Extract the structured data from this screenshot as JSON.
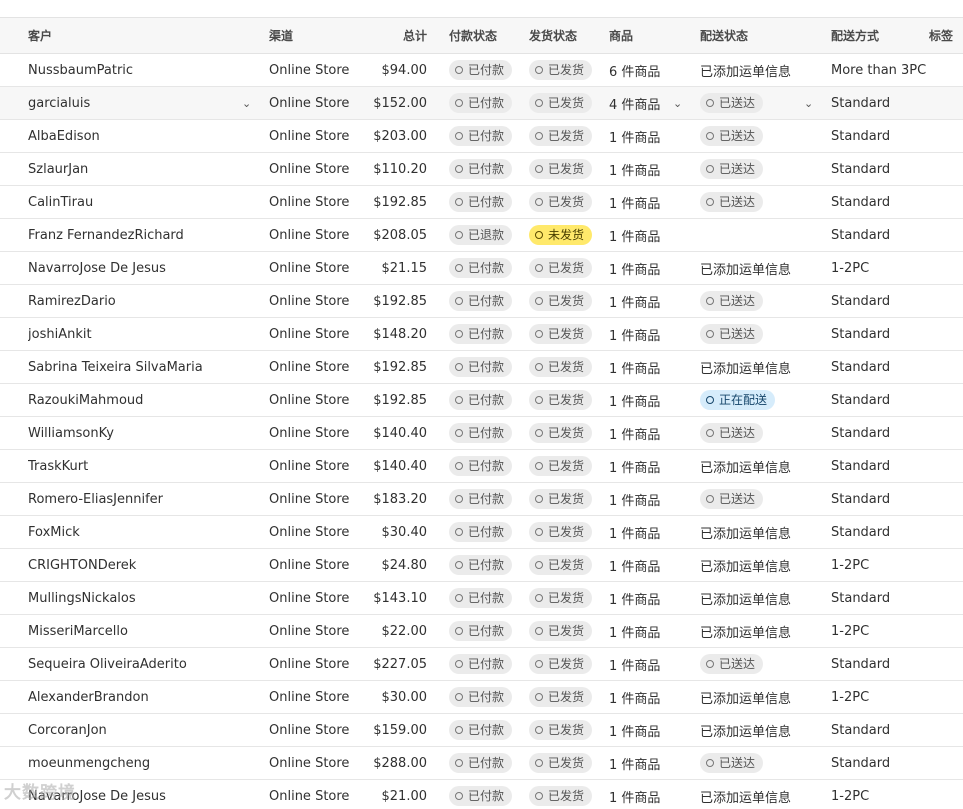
{
  "columns": {
    "customer": "客户",
    "channel": "渠道",
    "total": "总计",
    "payment": "付款状态",
    "fulfillment": "发货状态",
    "items": "商品",
    "delivery": "配送状态",
    "method": "配送方式",
    "tags": "标签"
  },
  "rows": [
    {
      "customer": "NussbaumPatric",
      "channel": "Online Store",
      "total": "$94.00",
      "payment": "已付款",
      "fulfillment": "已发货",
      "fulfillment_type": "neutral",
      "items": "6 件商品",
      "delivery": "已添加运单信息",
      "delivery_type": "text",
      "method": "More than 3PC"
    },
    {
      "customer": "garcialuis",
      "channel": "Online Store",
      "total": "$152.00",
      "payment": "已付款",
      "fulfillment": "已发货",
      "fulfillment_type": "neutral",
      "items": "4 件商品",
      "delivery": "已送达",
      "delivery_type": "badge",
      "method": "Standard"
    },
    {
      "customer": "AlbaEdison",
      "channel": "Online Store",
      "total": "$203.00",
      "payment": "已付款",
      "fulfillment": "已发货",
      "fulfillment_type": "neutral",
      "items": "1 件商品",
      "delivery": "已送达",
      "delivery_type": "badge",
      "method": "Standard"
    },
    {
      "customer": "SzlaurJan",
      "channel": "Online Store",
      "total": "$110.20",
      "payment": "已付款",
      "fulfillment": "已发货",
      "fulfillment_type": "neutral",
      "items": "1 件商品",
      "delivery": "已送达",
      "delivery_type": "badge",
      "method": "Standard"
    },
    {
      "customer": "CalinTirau",
      "channel": "Online Store",
      "total": "$192.85",
      "payment": "已付款",
      "fulfillment": "已发货",
      "fulfillment_type": "neutral",
      "items": "1 件商品",
      "delivery": "已送达",
      "delivery_type": "badge",
      "method": "Standard"
    },
    {
      "customer": "Franz FernandezRichard",
      "channel": "Online Store",
      "total": "$208.05",
      "payment": "已退款",
      "fulfillment": "未发货",
      "fulfillment_type": "warn",
      "items": "1 件商品",
      "delivery": "",
      "delivery_type": "none",
      "method": "Standard"
    },
    {
      "customer": "NavarroJose De Jesus",
      "channel": "Online Store",
      "total": "$21.15",
      "payment": "已付款",
      "fulfillment": "已发货",
      "fulfillment_type": "neutral",
      "items": "1 件商品",
      "delivery": "已添加运单信息",
      "delivery_type": "text",
      "method": "1-2PC"
    },
    {
      "customer": "RamirezDario",
      "channel": "Online Store",
      "total": "$192.85",
      "payment": "已付款",
      "fulfillment": "已发货",
      "fulfillment_type": "neutral",
      "items": "1 件商品",
      "delivery": "已送达",
      "delivery_type": "badge",
      "method": "Standard"
    },
    {
      "customer": "joshiAnkit",
      "channel": "Online Store",
      "total": "$148.20",
      "payment": "已付款",
      "fulfillment": "已发货",
      "fulfillment_type": "neutral",
      "items": "1 件商品",
      "delivery": "已送达",
      "delivery_type": "badge",
      "method": "Standard"
    },
    {
      "customer": "Sabrina Teixeira SilvaMaria",
      "channel": "Online Store",
      "total": "$192.85",
      "payment": "已付款",
      "fulfillment": "已发货",
      "fulfillment_type": "neutral",
      "items": "1 件商品",
      "delivery": "已添加运单信息",
      "delivery_type": "text",
      "method": "Standard"
    },
    {
      "customer": "RazoukiMahmoud",
      "channel": "Online Store",
      "total": "$192.85",
      "payment": "已付款",
      "fulfillment": "已发货",
      "fulfillment_type": "neutral",
      "items": "1 件商品",
      "delivery": "正在配送",
      "delivery_type": "info",
      "method": "Standard"
    },
    {
      "customer": "WilliamsonKy",
      "channel": "Online Store",
      "total": "$140.40",
      "payment": "已付款",
      "fulfillment": "已发货",
      "fulfillment_type": "neutral",
      "items": "1 件商品",
      "delivery": "已送达",
      "delivery_type": "badge",
      "method": "Standard"
    },
    {
      "customer": "TraskKurt",
      "channel": "Online Store",
      "total": "$140.40",
      "payment": "已付款",
      "fulfillment": "已发货",
      "fulfillment_type": "neutral",
      "items": "1 件商品",
      "delivery": "已添加运单信息",
      "delivery_type": "text",
      "method": "Standard"
    },
    {
      "customer": "Romero-EliasJennifer",
      "channel": "Online Store",
      "total": "$183.20",
      "payment": "已付款",
      "fulfillment": "已发货",
      "fulfillment_type": "neutral",
      "items": "1 件商品",
      "delivery": "已送达",
      "delivery_type": "badge",
      "method": "Standard"
    },
    {
      "customer": "FoxMick",
      "channel": "Online Store",
      "total": "$30.40",
      "payment": "已付款",
      "fulfillment": "已发货",
      "fulfillment_type": "neutral",
      "items": "1 件商品",
      "delivery": "已添加运单信息",
      "delivery_type": "text",
      "method": "Standard"
    },
    {
      "customer": "CRIGHTONDerek",
      "channel": "Online Store",
      "total": "$24.80",
      "payment": "已付款",
      "fulfillment": "已发货",
      "fulfillment_type": "neutral",
      "items": "1 件商品",
      "delivery": "已添加运单信息",
      "delivery_type": "text",
      "method": "1-2PC"
    },
    {
      "customer": "MullingsNickalos",
      "channel": "Online Store",
      "total": "$143.10",
      "payment": "已付款",
      "fulfillment": "已发货",
      "fulfillment_type": "neutral",
      "items": "1 件商品",
      "delivery": "已添加运单信息",
      "delivery_type": "text",
      "method": "Standard"
    },
    {
      "customer": "MisseriMarcello",
      "channel": "Online Store",
      "total": "$22.00",
      "payment": "已付款",
      "fulfillment": "已发货",
      "fulfillment_type": "neutral",
      "items": "1 件商品",
      "delivery": "已添加运单信息",
      "delivery_type": "text",
      "method": "1-2PC"
    },
    {
      "customer": "Sequeira OliveiraAderito",
      "channel": "Online Store",
      "total": "$227.05",
      "payment": "已付款",
      "fulfillment": "已发货",
      "fulfillment_type": "neutral",
      "items": "1 件商品",
      "delivery": "已送达",
      "delivery_type": "badge",
      "method": "Standard"
    },
    {
      "customer": "AlexanderBrandon",
      "channel": "Online Store",
      "total": "$30.00",
      "payment": "已付款",
      "fulfillment": "已发货",
      "fulfillment_type": "neutral",
      "items": "1 件商品",
      "delivery": "已添加运单信息",
      "delivery_type": "text",
      "method": "1-2PC"
    },
    {
      "customer": "CorcoranJon",
      "channel": "Online Store",
      "total": "$159.00",
      "payment": "已付款",
      "fulfillment": "已发货",
      "fulfillment_type": "neutral",
      "items": "1 件商品",
      "delivery": "已添加运单信息",
      "delivery_type": "text",
      "method": "Standard"
    },
    {
      "customer": "moeunmengcheng",
      "channel": "Online Store",
      "total": "$288.00",
      "payment": "已付款",
      "fulfillment": "已发货",
      "fulfillment_type": "neutral",
      "items": "1 件商品",
      "delivery": "已送达",
      "delivery_type": "badge",
      "method": "Standard"
    },
    {
      "customer": "NavarroJose De Jesus",
      "channel": "Online Store",
      "total": "$21.00",
      "payment": "已付款",
      "fulfillment": "已发货",
      "fulfillment_type": "neutral",
      "items": "1 件商品",
      "delivery": "已添加运单信息",
      "delivery_type": "text",
      "method": "1-2PC"
    }
  ],
  "hover_row_index": 1,
  "watermark": "大数跨境",
  "colors": {
    "header_bg": "#f7f7f7",
    "badge_neutral": "#ebebeb",
    "badge_warn": "#ffe96b",
    "badge_info": "#d6ecfb",
    "row_border": "#e6e6e6"
  }
}
